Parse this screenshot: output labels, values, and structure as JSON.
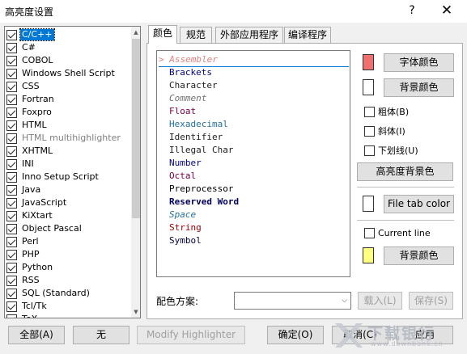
{
  "window": {
    "title": "高亮度设置",
    "help_label": "?",
    "close_label": "✕"
  },
  "languages": [
    {
      "label": "C/C++",
      "checked": true,
      "selected": true,
      "disabled": false
    },
    {
      "label": "C#",
      "checked": true,
      "selected": false,
      "disabled": false
    },
    {
      "label": "COBOL",
      "checked": true,
      "selected": false,
      "disabled": false
    },
    {
      "label": "Windows Shell Script",
      "checked": true,
      "selected": false,
      "disabled": false
    },
    {
      "label": "CSS",
      "checked": true,
      "selected": false,
      "disabled": false
    },
    {
      "label": "Fortran",
      "checked": true,
      "selected": false,
      "disabled": false
    },
    {
      "label": "Foxpro",
      "checked": true,
      "selected": false,
      "disabled": false
    },
    {
      "label": "HTML",
      "checked": true,
      "selected": false,
      "disabled": false
    },
    {
      "label": "HTML multihighlighter",
      "checked": true,
      "selected": false,
      "disabled": true
    },
    {
      "label": "XHTML",
      "checked": true,
      "selected": false,
      "disabled": false
    },
    {
      "label": "INI",
      "checked": true,
      "selected": false,
      "disabled": false
    },
    {
      "label": "Inno Setup Script",
      "checked": true,
      "selected": false,
      "disabled": false
    },
    {
      "label": "Java",
      "checked": true,
      "selected": false,
      "disabled": false
    },
    {
      "label": "JavaScript",
      "checked": true,
      "selected": false,
      "disabled": false
    },
    {
      "label": "KiXtart",
      "checked": true,
      "selected": false,
      "disabled": false
    },
    {
      "label": "Object Pascal",
      "checked": true,
      "selected": false,
      "disabled": false
    },
    {
      "label": "Perl",
      "checked": true,
      "selected": false,
      "disabled": false
    },
    {
      "label": "PHP",
      "checked": true,
      "selected": false,
      "disabled": false
    },
    {
      "label": "Python",
      "checked": true,
      "selected": false,
      "disabled": false
    },
    {
      "label": "RSS",
      "checked": true,
      "selected": false,
      "disabled": false
    },
    {
      "label": "SQL (Standard)",
      "checked": true,
      "selected": false,
      "disabled": false
    },
    {
      "label": "Tcl/Tk",
      "checked": true,
      "selected": false,
      "disabled": false
    },
    {
      "label": "TeX",
      "checked": true,
      "selected": false,
      "disabled": false
    }
  ],
  "tabs": [
    {
      "label": "颜色",
      "active": true
    },
    {
      "label": "规范",
      "active": false
    },
    {
      "label": "外部应用程序",
      "active": false
    },
    {
      "label": "编译程序",
      "active": false
    }
  ],
  "style_items": [
    {
      "label": "> Assembler",
      "color": "#e08080",
      "italic": true,
      "bold": false
    },
    {
      "label": "Brackets",
      "color": "#000080",
      "italic": false,
      "bold": false
    },
    {
      "label": "Character",
      "color": "#202020",
      "italic": false,
      "bold": false
    },
    {
      "label": "Comment",
      "color": "#707070",
      "italic": true,
      "bold": false
    },
    {
      "label": "Float",
      "color": "#800040",
      "italic": false,
      "bold": false
    },
    {
      "label": "Hexadecimal",
      "color": "#2070a0",
      "italic": false,
      "bold": false
    },
    {
      "label": "Identifier",
      "color": "#202020",
      "italic": false,
      "bold": false
    },
    {
      "label": "Illegal Char",
      "color": "#202020",
      "italic": false,
      "bold": false
    },
    {
      "label": "Number",
      "color": "#000080",
      "italic": false,
      "bold": false
    },
    {
      "label": "Octal",
      "color": "#800040",
      "italic": false,
      "bold": false
    },
    {
      "label": "Preprocessor",
      "color": "#000000",
      "italic": false,
      "bold": false
    },
    {
      "label": "Reserved Word",
      "color": "#000060",
      "italic": false,
      "bold": true
    },
    {
      "label": "Space",
      "color": "#2070a0",
      "italic": true,
      "bold": false
    },
    {
      "label": "String",
      "color": "#a00000",
      "italic": false,
      "bold": false
    },
    {
      "label": "Symbol",
      "color": "#000040",
      "italic": false,
      "bold": false
    }
  ],
  "controls": {
    "font_color_label": "字体颜色",
    "font_color": "#f07070",
    "bg_color_label": "背景颜色",
    "bg_color": "#ffffff",
    "bold_label": "粗体(B)",
    "italic_label": "斜体(I)",
    "underline_label": "下划线(U)",
    "highlight_bg_label": "高亮度背景色",
    "file_tab_color_label": "File tab color",
    "file_tab_color": "#ffffff",
    "current_line_label": "Current line",
    "current_line_bg_label": "背景颜色",
    "current_line_color": "#ffff80"
  },
  "scheme": {
    "label": "配色方案:",
    "value": "",
    "load_label": "载入(L)",
    "save_label": "保存(S)"
  },
  "bottom": {
    "all_label": "全部(A)",
    "none_label": "无",
    "modify_label": "Modify Highlighter",
    "ok_label": "确定(O)",
    "cancel_label": "取消(C)",
    "apply_label": "应用"
  },
  "watermark": {
    "main": "下载银行",
    "sub": "www.downbank.cn"
  }
}
